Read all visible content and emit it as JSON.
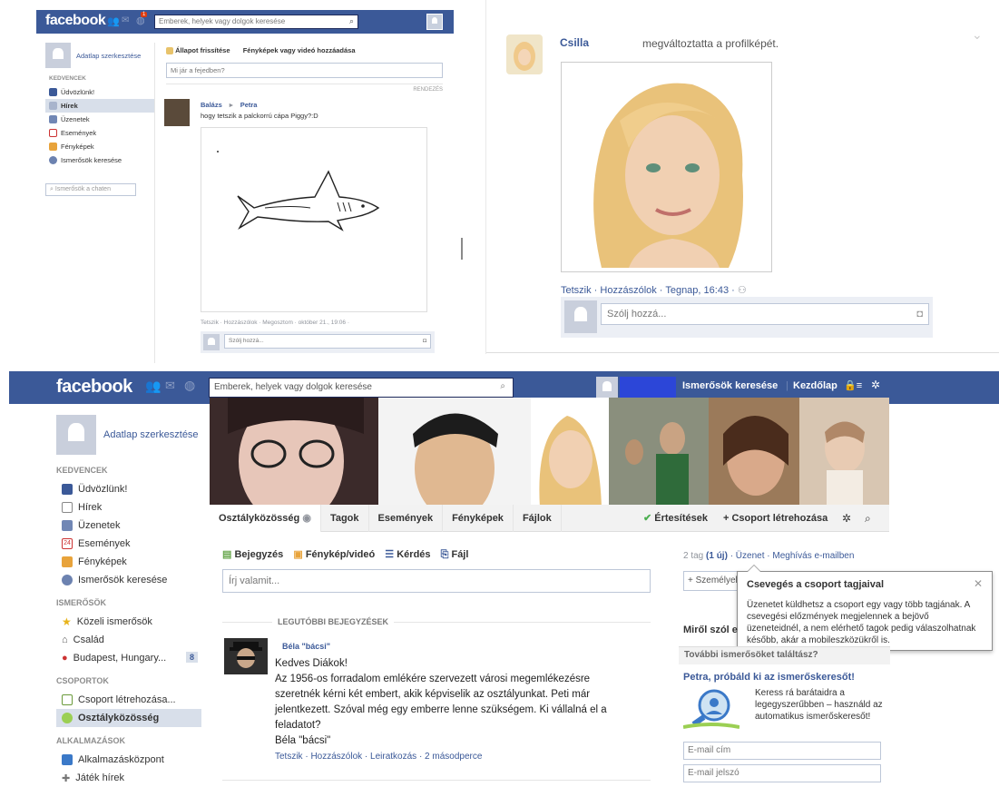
{
  "panel_top_left": {
    "logo": "facebook",
    "search_placeholder": "Emberek, helyek vagy dolgok keresése",
    "profile_edit": "Adatlap szerkesztése",
    "favorites_header": "KEDVENCEK",
    "nav": [
      "Üdvözlünk!",
      "Hírek",
      "Üzenetek",
      "Események",
      "Fényképek",
      "Ismerősök keresése"
    ],
    "chat_search": "Ismerősök a chaten",
    "status_tab": "Állapot frissítése",
    "photo_tab": "Fényképek vagy videó hozzáadása",
    "composer_placeholder": "Mi jár a fejedben?",
    "sort_label": "RENDEZÉS",
    "post": {
      "author": "Balázs",
      "arrow": "▸",
      "target": "Petra",
      "text": "hogy tetszik a palckorrú cápa Piggy?:D",
      "actions": "Tetszik · Hozzászólok · Megosztom · október 21., 19:06 ·",
      "comment_placeholder": "Szólj hozzá..."
    }
  },
  "panel_top_right": {
    "name": "Csilla",
    "action": "megváltoztatta a profilképét.",
    "footer": "Tetszik · Hozzászólok · Tegnap, 16:43 ·",
    "comment_placeholder": "Szólj hozzá..."
  },
  "panel_bottom": {
    "logo": "facebook",
    "search_placeholder": "Emberek, helyek vagy dolgok keresése",
    "find_friends": "Ismerősök keresése",
    "home": "Kezdőlap",
    "profile_edit": "Adatlap szerkesztése",
    "favorites_header": "KEDVENCEK",
    "favorites": [
      "Üdvözlünk!",
      "Hírek",
      "Üzenetek",
      "Események",
      "Fényképek",
      "Ismerősök keresése"
    ],
    "friends_header": "ISMERŐSÖK",
    "friends": [
      "Közeli ismerősök",
      "Család",
      "Budapest, Hungary..."
    ],
    "budapest_count": "8",
    "groups_header": "CSOPORTOK",
    "groups": [
      "Csoport létrehozása...",
      "Osztályközösség"
    ],
    "apps_header": "ALKALMAZÁSOK",
    "apps": [
      "Alkalmazásközpont",
      "Játék hírek"
    ],
    "tabs": [
      "Osztályközösség",
      "Tagok",
      "Események",
      "Fényképek",
      "Fájlok"
    ],
    "notifications": "Értesítések",
    "create_group": "+ Csoport létrehozása",
    "composer_tabs": [
      "Bejegyzés",
      "Fénykép/videó",
      "Kérdés",
      "Fájl"
    ],
    "composer_placeholder": "Írj valamit...",
    "recent_posts": "LEGUTÓBBI BEJEGYZÉSEK",
    "post": {
      "author": "Béla \"bácsi\"",
      "lines": [
        "Kedves Diákok!",
        "Az 1956-os forradalom emlékére szervezett városi megemlékezésre",
        "szeretnék kérni két embert, akik képviselik az osztályunkat. Peti már",
        "jelentkezett. Szóval még egy emberre lenne szükségem. Ki vállalná el a",
        "feladatot?",
        "Béla \"bácsi\""
      ],
      "actions": "Tetszik · Hozzászólok · Leiratkozás · 2 másodperce"
    },
    "members_line_a": "2 tag",
    "members_line_b": "(1 új)",
    "members_line_c": "· Üzenet · Meghívás e-mailben",
    "add_person": "+ Személyek",
    "popup_title": "Csevegés a csoport tagjaival",
    "popup_body": "Üzenetet küldhetsz a csoport egy vagy több tagjának. A csevegési előzmények megjelennek a bejövő üzeneteidnél, a nem elérhető tagok pedig válaszolhatnak később, akár a mobileszközükről is.",
    "about_partial": "Miről szól e",
    "more_friends": "További ismerősöket találtász?",
    "petra_try": "Petra, próbáld ki az ismerőskeresőt!",
    "finder_text": "Keress rá barátaidra a legegyszerűbben – használd az automatikus ismerőskeresőt!",
    "email_placeholder": "E-mail cím",
    "password_placeholder": "E-mail jelszó"
  },
  "colors": {
    "brand": "#3b5998",
    "link": "#3b5998",
    "green_check": "#4caf50"
  }
}
